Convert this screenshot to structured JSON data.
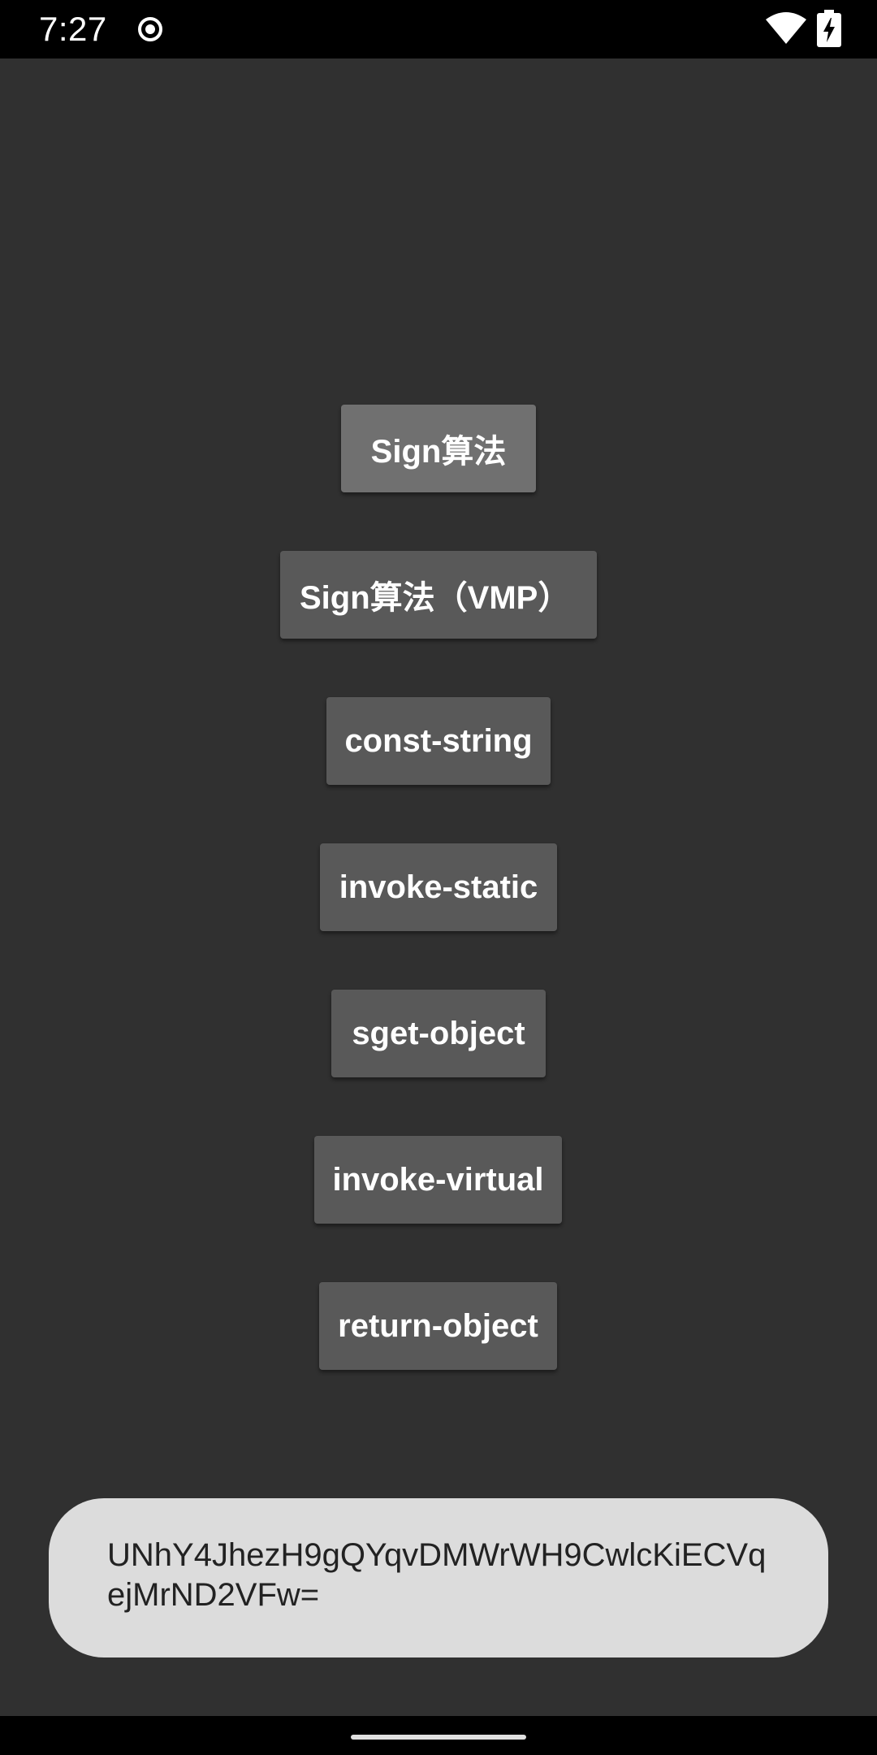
{
  "status_bar": {
    "time": "7:27",
    "icons": [
      "sync-icon",
      "wifi-icon",
      "battery-charging-icon"
    ]
  },
  "buttons": {
    "sign": "Sign算法",
    "sign_vmp": "Sign算法（VMP）",
    "const_string": "const-string",
    "invoke_static": "invoke-static",
    "sget_object": "sget-object",
    "invoke_virtual": "invoke-virtual",
    "return_object": "return-object"
  },
  "toast": {
    "text": "UNhY4JhezH9gQYqvDMWrWH9CwlcKiECVqejMrND2VFw="
  },
  "colors": {
    "background": "#303030",
    "button": "#595959",
    "button_pressed": "#707070",
    "toast": "#dcdcdc",
    "status_bar": "#000000"
  }
}
